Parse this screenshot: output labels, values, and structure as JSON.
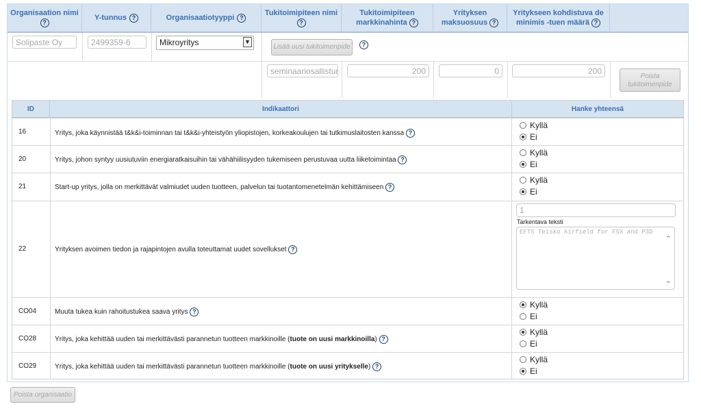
{
  "org_table": {
    "headers": [
      {
        "line1": "Organisaation nimi",
        "line2": ""
      },
      {
        "line1": "Y-tunnus",
        "line2": ""
      },
      {
        "line1": "Organisaatiotyyppi",
        "line2": ""
      },
      {
        "line1": "Tukitoimipiteen nimi",
        "line2": ""
      },
      {
        "line1": "Tukitoimipiteen",
        "line2": "markkinahinta"
      },
      {
        "line1": "Yrityksen",
        "line2": "maksuosuus"
      },
      {
        "line1": "Yritykseen kohdistuva de",
        "line2": "minimis -tuen määrä"
      }
    ],
    "org_name_value": "Solipaste Oy",
    "business_id_value": "2499359-6",
    "org_type_selected": "Mikroyritys",
    "add_measure_label": "Lisää uusi tukitoimenpide",
    "measure": {
      "name_value": "seminaariosallistumi",
      "market_price_value": "200",
      "company_share_value": "0",
      "de_minimis_value": "200",
      "remove_label_line1": "Poista",
      "remove_label_line2": "tukitoimenpide"
    }
  },
  "indicator_table": {
    "headers": {
      "id": "ID",
      "indicator": "Indikaattori",
      "total": "Hanke yhteensä"
    },
    "yes_label": "Kyllä",
    "no_label": "Ei",
    "rows": [
      {
        "id": "16",
        "text": "Yritys, joka käynnistää t&k&i-toiminnan tai t&k&i-yhteistyön yliopistojen, korkeakoulujen tai tutkimuslaitosten kanssa",
        "bold": "",
        "suffix": "",
        "answer": "Ei"
      },
      {
        "id": "20",
        "text": "Yritys, johon syntyy uusiutuviin energiaratkaisuihin tai vähähiilisyyden tukemiseen perustuvaa uutta liiketoimintaa",
        "bold": "",
        "suffix": "",
        "answer": "Ei"
      },
      {
        "id": "21",
        "text": "Start-up yritys, jolla on merkittävät valmiudet uuden tuotteen, palvelun tai tuotantomenetelmän kehittämiseen",
        "bold": "",
        "suffix": "",
        "answer": "Ei"
      },
      {
        "id": "22",
        "text": "Yrityksen avoimen tiedon ja rajapintojen avulla toteuttamat uudet sovellukset",
        "bold": "",
        "suffix": "",
        "count_value": "1",
        "clarifying_label": "Tarkentava teksti",
        "clarifying_value": "EFTS Teisko Airfield for FSX and P3D"
      },
      {
        "id": "CO04",
        "text": "Muuta tukea kuin rahoitustukea saava yritys",
        "bold": "",
        "suffix": "",
        "answer": "Kyllä"
      },
      {
        "id": "CO28",
        "text": "Yritys, joka kehittää uuden tai merkittävästi parannetun tuotteen markkinoille (",
        "bold": "tuote on uusi markkinoilla",
        "suffix": ")",
        "answer": "Kyllä"
      },
      {
        "id": "CO29",
        "text": "Yritys, joka kehittää uuden tai merkittävästi parannetun tuotteen markkinoille (",
        "bold": "tuote on uusi yritykselle",
        "suffix": ")",
        "answer": "Ei"
      }
    ]
  },
  "remove_org_label": "Poista organisaatio",
  "colors": {
    "header_bg": "#d6e4f2",
    "header_text": "#3b6fb0",
    "help_icon": "#1c3f6a"
  },
  "icons": {
    "help": "question-circle-icon",
    "select_arrow": "chevron-down-icon",
    "scroll_up": "chevron-up-icon"
  }
}
